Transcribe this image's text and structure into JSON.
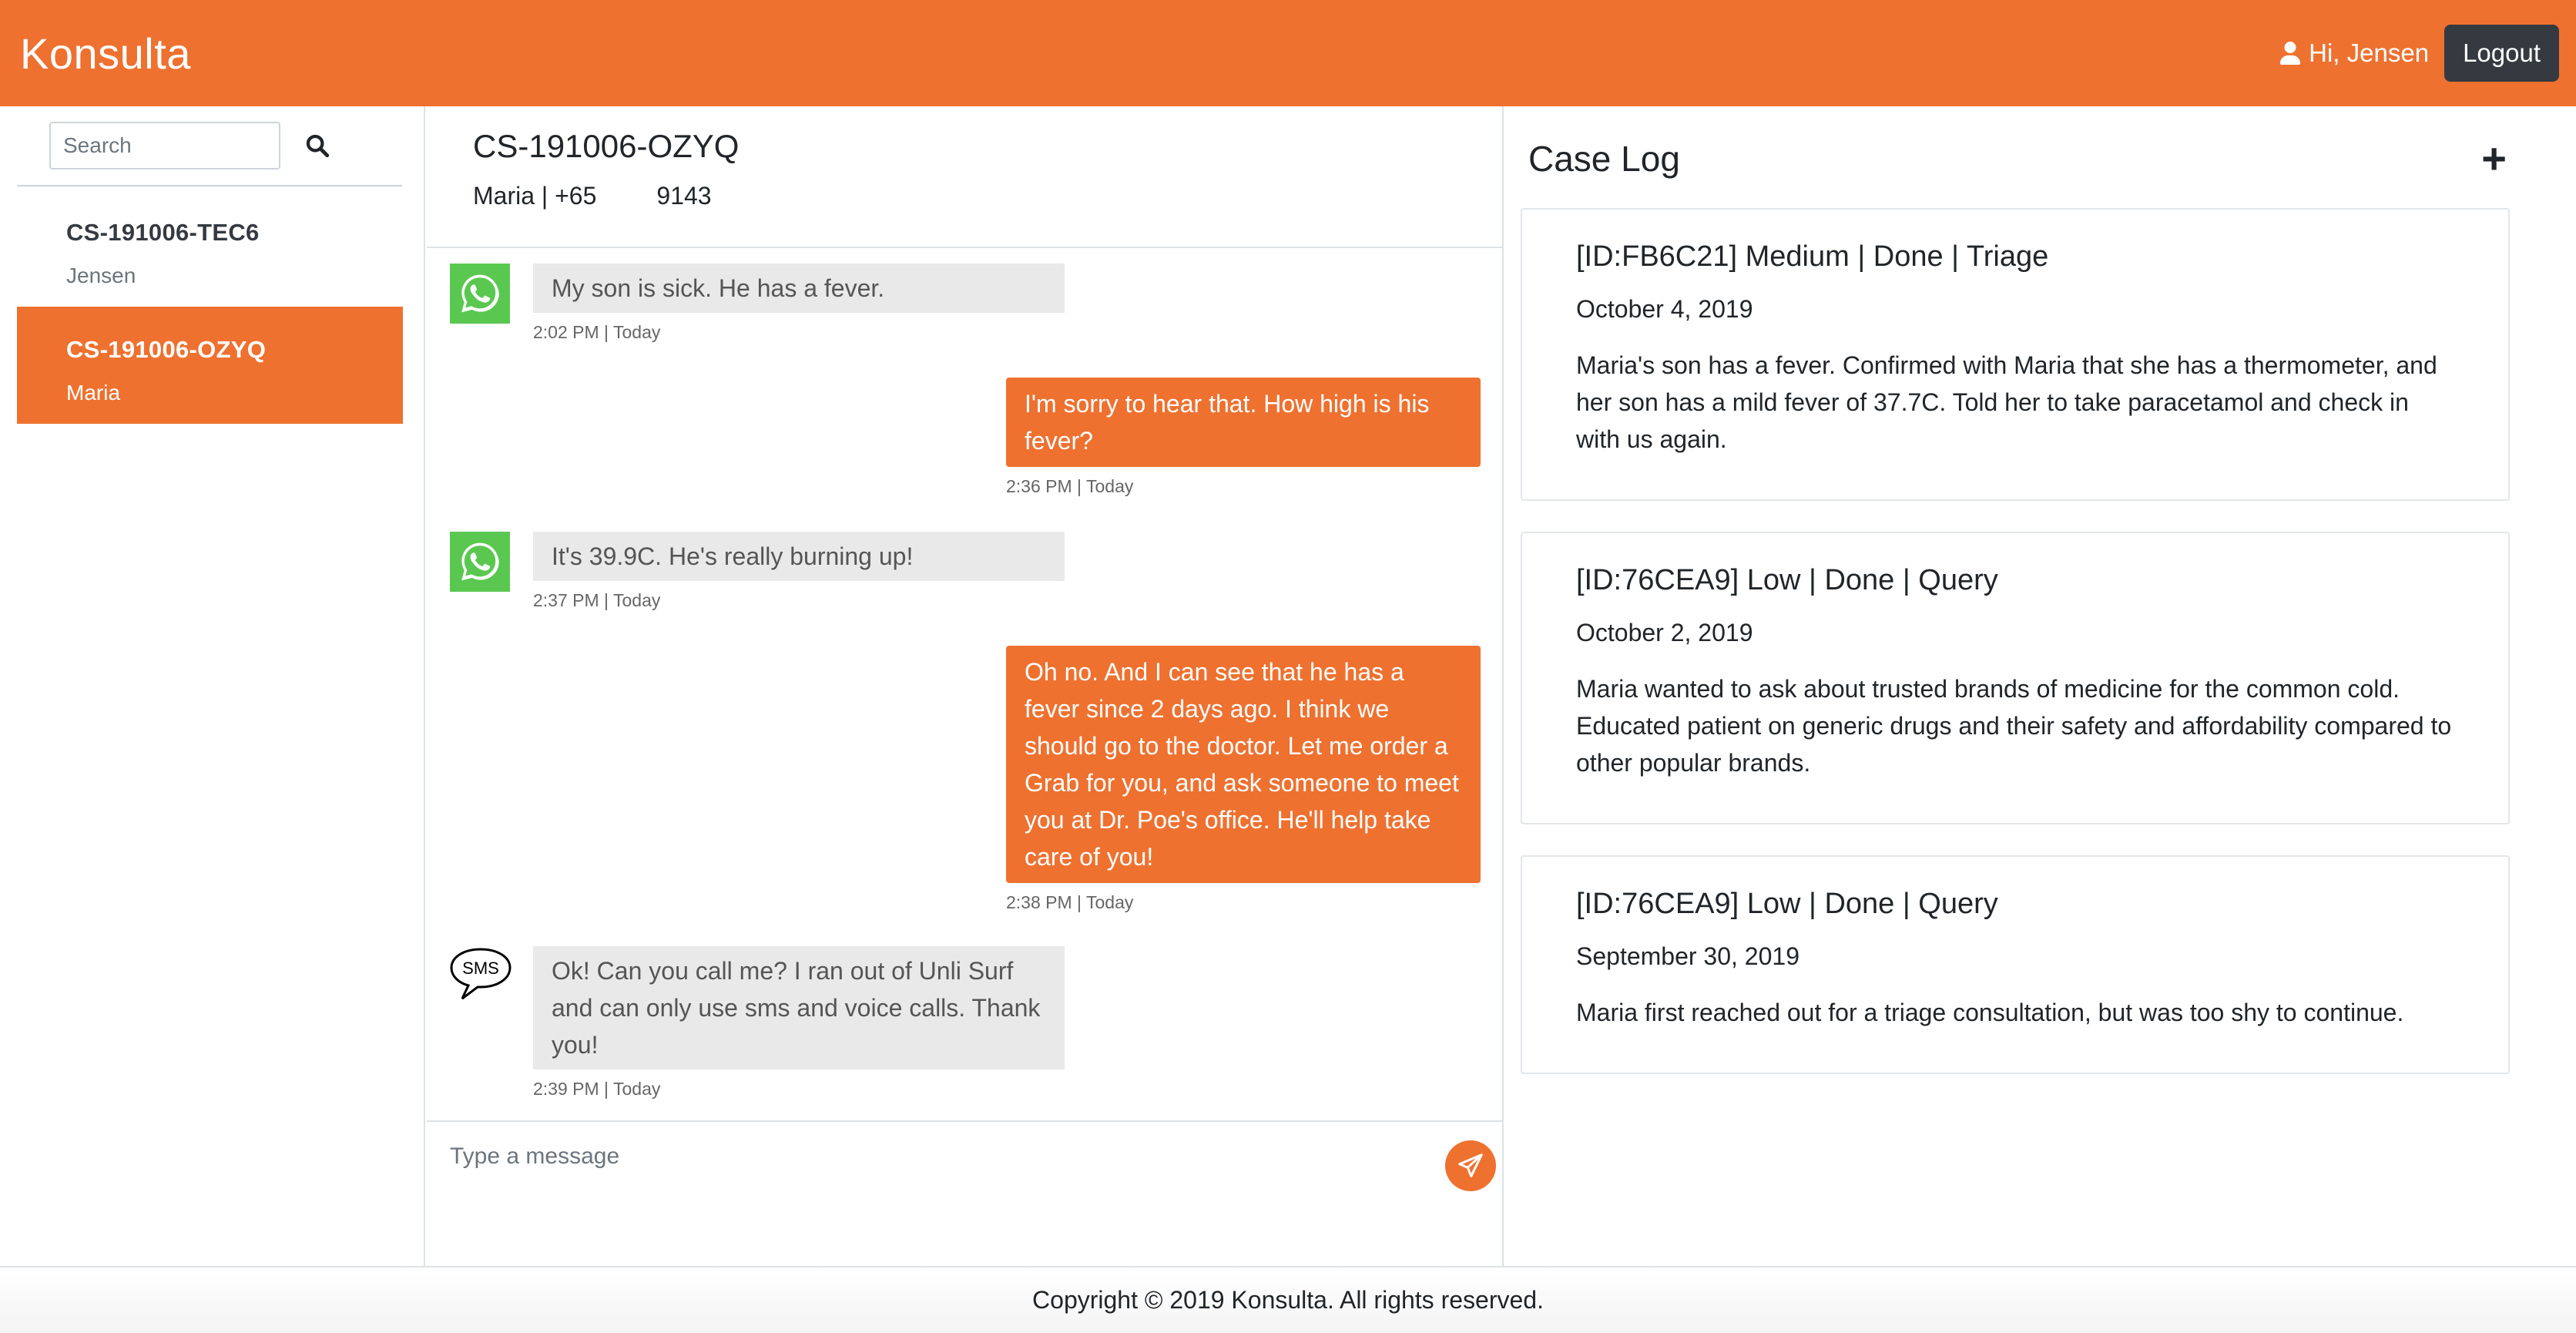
{
  "app": {
    "brand": "Konsulta"
  },
  "navbar": {
    "greeting": "Hi, Jensen",
    "logout_label": "Logout",
    "accent": "#ee7130"
  },
  "sidebar": {
    "search_placeholder": "Search",
    "cases": [
      {
        "id": "CS-191006-TEC6",
        "name": "Jensen",
        "active": false
      },
      {
        "id": "CS-191006-OZYQ",
        "name": "Maria",
        "active": true
      }
    ]
  },
  "chat": {
    "case_id": "CS-191006-OZYQ",
    "contact_name": "Maria | +65",
    "contact_phone_tail": "9143",
    "messages": [
      {
        "direction": "in",
        "channel": "whatsapp",
        "text": "My son is sick. He has a fever.",
        "meta": "2:02 PM | Today"
      },
      {
        "direction": "out",
        "text": "I'm sorry to hear that. How high is his fever?",
        "meta": "2:36 PM | Today"
      },
      {
        "direction": "in",
        "channel": "whatsapp",
        "text": "It's 39.9C. He's really burning up!",
        "meta": "2:37 PM | Today"
      },
      {
        "direction": "out",
        "text": "Oh no. And I can see that he has a fever since 2 days ago. I think we should go to the doctor. Let me order a Grab for you, and ask someone to meet you at Dr. Poe's office. He'll help take care of you!",
        "meta": "2:38 PM | Today"
      },
      {
        "direction": "in",
        "channel": "sms",
        "channel_label": "SMS",
        "text": "Ok! Can you call me? I ran out of Unli Surf and can only use sms and voice calls. Thank you!",
        "meta": "2:39 PM | Today"
      }
    ],
    "composer_placeholder": "Type a message"
  },
  "caselog": {
    "title": "Case Log",
    "add_label": "+",
    "entries": [
      {
        "title": "[ID:FB6C21] Medium | Done | Triage",
        "date": "October 4, 2019",
        "text": "Maria's son has a fever. Confirmed with Maria that she has a thermometer, and her son has a mild fever of 37.7C. Told her to take paracetamol and check in with us again."
      },
      {
        "title": "[ID:76CEA9] Low | Done | Query",
        "date": "October 2, 2019",
        "text": "Maria wanted to ask about trusted brands of medicine for the common cold. Educated patient on generic drugs and their safety and affordability compared to other popular brands."
      },
      {
        "title": "[ID:76CEA9] Low | Done | Query",
        "date": "September 30, 2019",
        "text": "Maria first reached out for a triage consultation, but was too shy to continue."
      }
    ]
  },
  "footer": {
    "copyright": "Copyright © 2019 Konsulta. All rights reserved."
  }
}
